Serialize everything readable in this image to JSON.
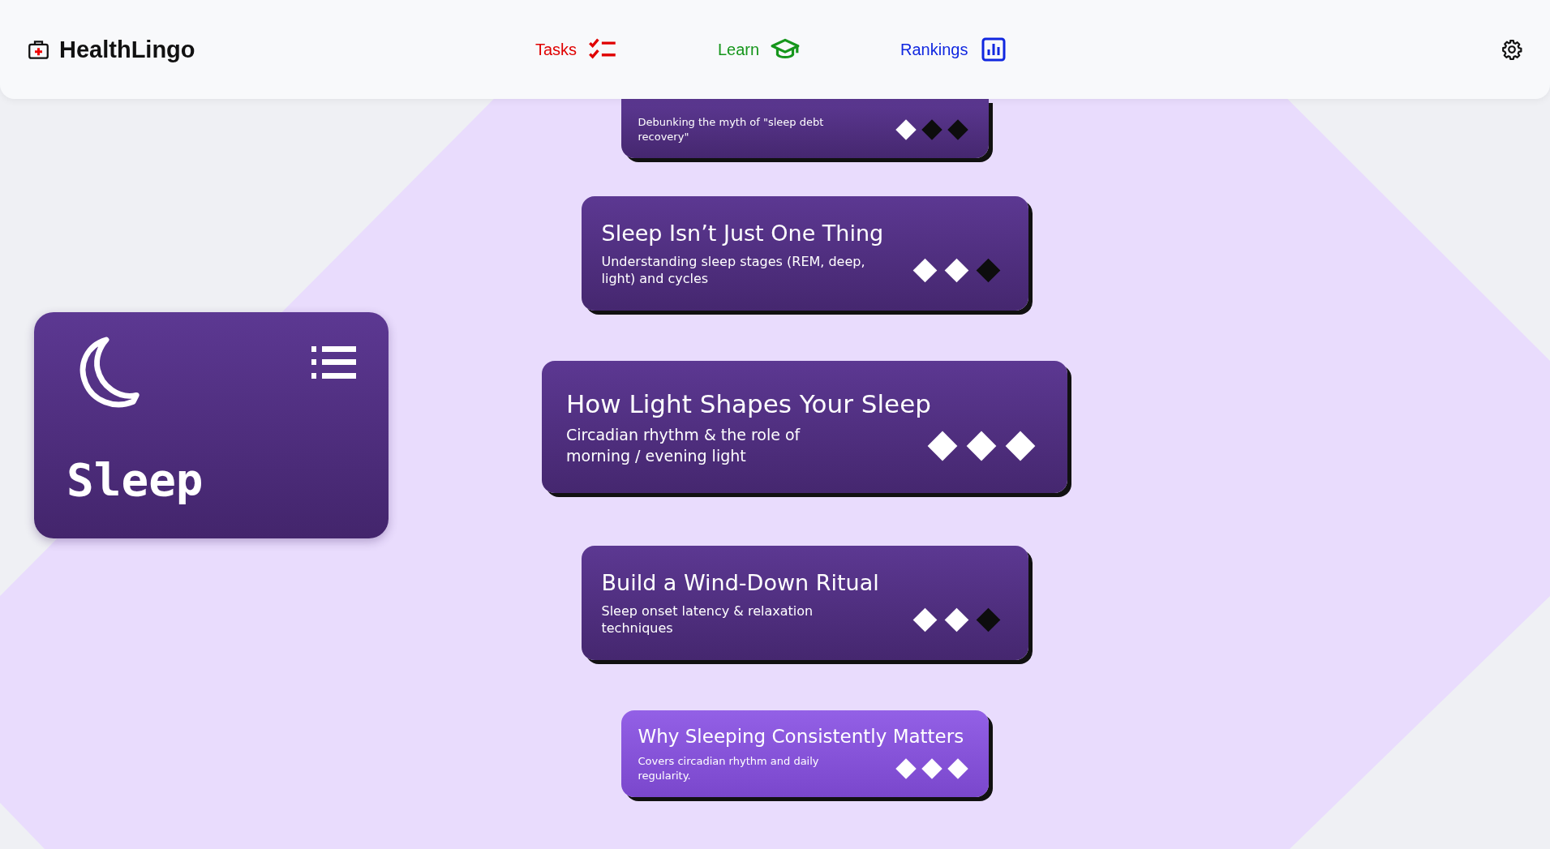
{
  "header": {
    "title": "HealthLingo",
    "nav": [
      {
        "label": "Tasks",
        "kind": "tasks"
      },
      {
        "label": "Learn",
        "kind": "learn"
      },
      {
        "label": "Rankings",
        "kind": "rankings"
      }
    ]
  },
  "unit": {
    "title": "Sleep"
  },
  "lessons": [
    {
      "description": "Debunking the myth of \"sleep debt recovery\"",
      "stars": 1,
      "selected": false
    },
    {
      "title": "Sleep Isn’t Just One Thing",
      "description": "Understanding sleep stages (REM, deep, light) and cycles",
      "stars": 2,
      "selected": false
    },
    {
      "title": "How Light Shapes Your Sleep",
      "description": "Circadian rhythm & the role of morning / evening light",
      "stars": 3,
      "selected": false
    },
    {
      "title": "Build a Wind-Down Ritual",
      "description": "Sleep onset latency & relaxation techniques",
      "stars": 2,
      "selected": false
    },
    {
      "title": "Why Sleeping Consistently Matters",
      "description": "Covers circadian rhythm and daily regularity.",
      "stars": 3,
      "selected": true
    }
  ]
}
